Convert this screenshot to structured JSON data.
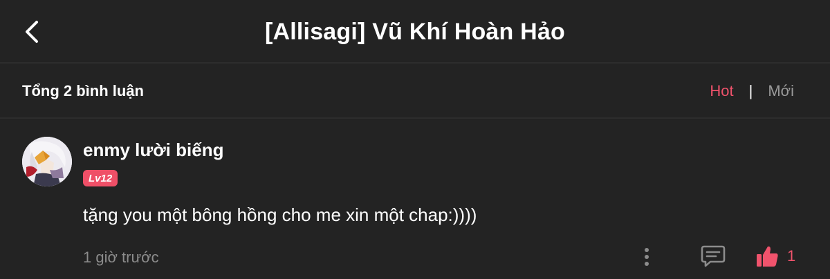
{
  "header": {
    "title": "[Allisagi] Vũ Khí Hoàn Hảo",
    "back_icon": "chevron-left-icon"
  },
  "comments_summary": {
    "total_label": "Tổng 2 bình luận",
    "sort": {
      "hot_label": "Hot",
      "separator": "|",
      "new_label": "Mới",
      "active": "Hot"
    }
  },
  "comments": [
    {
      "username": "enmy lười biếng",
      "level": "Lv12",
      "text": "tặng you một bông hồng cho me xin một chap:))))",
      "time": "1 giờ trước",
      "likes": "1",
      "liked": true
    }
  ],
  "colors": {
    "background": "#232323",
    "accent": "#f0536c",
    "muted_text": "#8c8c8c",
    "divider": "#2d2d2d"
  }
}
